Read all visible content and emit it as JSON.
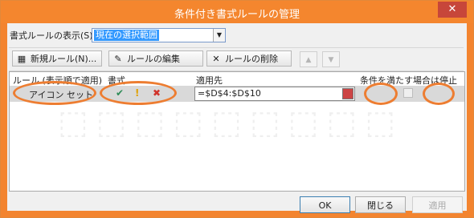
{
  "window": {
    "title": "条件付き書式ルールの管理",
    "close_glyph": "✕"
  },
  "show_rules": {
    "label": "書式ルールの表示(S):",
    "value": "現在の選択範囲"
  },
  "toolbar": {
    "new_rule": "新規ルール(N)...",
    "edit_rule": "ルールの編集(E)...",
    "delete_rule": "ルールの削除(D)",
    "move_up_glyph": "▲",
    "move_down_glyph": "▼"
  },
  "grid": {
    "headers": {
      "rule": "ルール (表示順で適用)",
      "format": "書式",
      "applies_to": "適用先",
      "stop_if_true": "条件を満たす場合は停止"
    },
    "rows": [
      {
        "rule": "アイコン セット",
        "format_icons": [
          "✔",
          "!",
          "✖"
        ],
        "applies_to": "=$D$4:$D$10"
      }
    ]
  },
  "buttons": {
    "ok": "OK",
    "close": "閉じる",
    "apply": "適用"
  },
  "colors": {
    "accent": "#ed7d31",
    "titlebar": "#f4862e",
    "icon_green": "#2e8b57",
    "icon_yellow": "#e0a000",
    "icon_red": "#d0342c"
  }
}
